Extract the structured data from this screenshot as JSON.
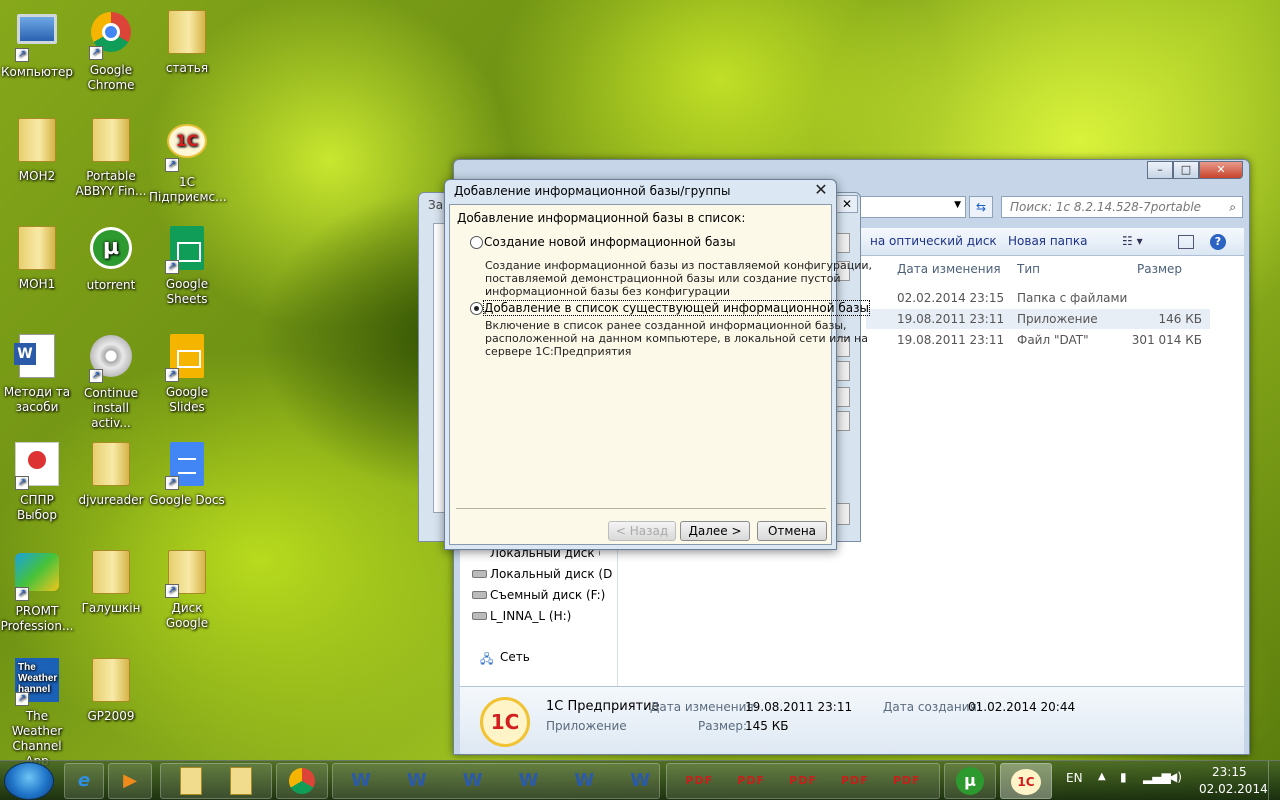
{
  "desktop": {
    "icons": [
      {
        "label": "Компьютер"
      },
      {
        "label": "Google Chrome"
      },
      {
        "label": "статья"
      },
      {
        "label": "МОН2"
      },
      {
        "label": "Portable ABBYY Fin..."
      },
      {
        "label": "1С Підприємс..."
      },
      {
        "label": "МОН1"
      },
      {
        "label": "utorrent"
      },
      {
        "label": "Google Sheets"
      },
      {
        "label": "Методи та засоби"
      },
      {
        "label": "Continue install activ..."
      },
      {
        "label": "Google Slides"
      },
      {
        "label": "СППР Выбор"
      },
      {
        "label": "djvureader"
      },
      {
        "label": "Google Docs"
      },
      {
        "label": "PROMT Profession..."
      },
      {
        "label": "Галушкін"
      },
      {
        "label": "Диск Google"
      },
      {
        "label": "The Weather Channel App"
      },
      {
        "label": "GP2009"
      }
    ]
  },
  "explorer": {
    "search_placeholder": "Поиск: 1с 8.2.14.528-7portable",
    "toolbar": {
      "burn": "на оптический диск",
      "new_folder": "Новая папка"
    },
    "columns": {
      "date": "Дата изменения",
      "type": "Тип",
      "size": "Размер"
    },
    "files": [
      {
        "date": "02.02.2014 23:15",
        "type": "Папка с файлами",
        "size": ""
      },
      {
        "date": "19.08.2011 23:11",
        "type": "Приложение",
        "size": "146 КБ"
      },
      {
        "date": "19.08.2011 23:11",
        "type": "Файл \"DAT\"",
        "size": "301 014 КБ"
      }
    ],
    "nav": {
      "local_d": "Локальный диск (D",
      "removable_f": "Съемный диск (F:)",
      "drive_h": "L_INNA_L (H:)",
      "network": "Сеть",
      "local_partial": "Локальный диск (С"
    },
    "details": {
      "name": "1С Предприятие",
      "kind": "Приложение",
      "modified_label": "Дата изменения:",
      "modified": "19.08.2011 23:11",
      "size_label": "Размер:",
      "size": "145 КБ",
      "created_label": "Дата создания:",
      "created": "01.02.2014 20:44"
    }
  },
  "back_dialog": {
    "title_partial": "Зап"
  },
  "dialog": {
    "title": "Добавление информационной базы/группы",
    "header": "Добавление информационной базы в список:",
    "option1": {
      "label": "Создание новой информационной базы",
      "desc": [
        "Создание информационной базы из поставляемой конфигурации,",
        "поставляемой демонстрационной базы или создание пустой",
        "информационной базы без конфигурации"
      ],
      "selected": false
    },
    "option2": {
      "label": "Добавление в список существующей информационной базы",
      "desc": [
        "Включение в список ранее созданной информационной базы,",
        "расположенной на данном компьютере,  в локальной сети или на",
        "сервере 1С:Предприятия"
      ],
      "selected": true
    },
    "buttons": {
      "back": "< Назад",
      "next": "Далее >",
      "cancel": "Отмена"
    }
  },
  "taskbar": {
    "lang": "EN",
    "time": "23:15",
    "date": "02.02.2014"
  }
}
